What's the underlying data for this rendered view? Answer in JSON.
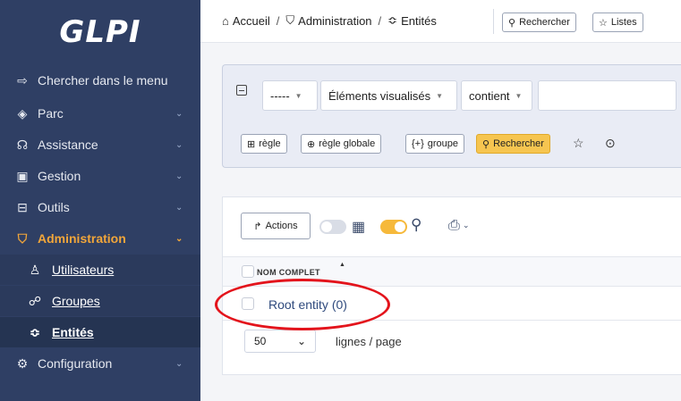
{
  "sidebar": {
    "logo": "GLPI",
    "items": [
      {
        "label": "Chercher dans le menu",
        "icon": "arrow-right-icon"
      },
      {
        "label": "Parc",
        "icon": "cube-icon"
      },
      {
        "label": "Assistance",
        "icon": "headset-icon"
      },
      {
        "label": "Gestion",
        "icon": "wallet-icon"
      },
      {
        "label": "Outils",
        "icon": "briefcase-icon"
      },
      {
        "label": "Administration",
        "icon": "shield-icon"
      },
      {
        "label": "Configuration",
        "icon": "gear-icon"
      }
    ],
    "subitems": [
      {
        "label": "Utilisateurs",
        "icon": "user-icon"
      },
      {
        "label": "Groupes",
        "icon": "users-icon"
      },
      {
        "label": "Entités",
        "icon": "stack-icon"
      }
    ],
    "accent_color": "#f2a63a"
  },
  "breadcrumb": {
    "home": "Accueil",
    "admin": "Administration",
    "current": "Entités"
  },
  "header": {
    "search_btn": "Rechercher",
    "lists_btn": "Listes"
  },
  "search": {
    "field1": "-----",
    "field2": "Éléments visualisés",
    "field3": "contient",
    "value": "",
    "btn_rule": "règle",
    "btn_global_rule": "règle globale",
    "btn_group": "groupe",
    "btn_search": "Rechercher"
  },
  "results": {
    "actions_label": "Actions",
    "column_header": "NOM COMPLET",
    "rows": [
      {
        "name": "Root entity (0)"
      }
    ],
    "page_size": "50",
    "page_size_label": "lignes / page"
  }
}
